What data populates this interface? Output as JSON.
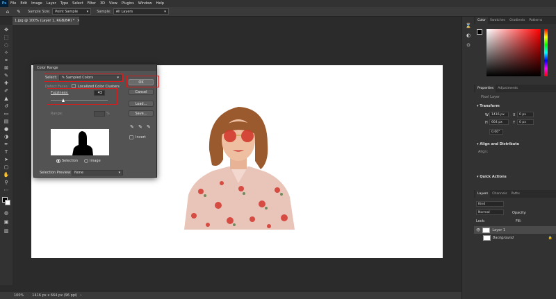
{
  "app": {
    "logo": "Ps",
    "menu": [
      "File",
      "Edit",
      "Image",
      "Layer",
      "Type",
      "Select",
      "Filter",
      "3D",
      "View",
      "Plugins",
      "Window",
      "Help"
    ]
  },
  "options": {
    "sample_size_label": "Sample Size:",
    "sample_size_value": "Point Sample",
    "sample_label": "Sample:",
    "sample_value": "All Layers"
  },
  "document": {
    "tab_title": "1.jpg @ 100% (Layer 1, RGB/8#) *"
  },
  "status": {
    "zoom": "100%",
    "info": "1416 px x 664 px (96 ppi)"
  },
  "color_panel": {
    "tabs": [
      "Color",
      "Swatches",
      "Gradients",
      "Patterns"
    ]
  },
  "properties_panel": {
    "tabs": [
      "Properties",
      "Adjustments"
    ],
    "layer_kind": "Pixel Layer",
    "transform_label": "Transform",
    "w_label": "W",
    "w_value": "1416 px",
    "h_label": "H",
    "h_value": "664 px",
    "x_label": "X",
    "x_value": "0 px",
    "y_label": "Y",
    "y_value": "0 px",
    "angle_value": "0.00°",
    "align_label": "Align and Distribute",
    "align_sub": "Align:",
    "quick_actions_label": "Quick Actions"
  },
  "layers_panel": {
    "tabs": [
      "Layers",
      "Channels",
      "Paths"
    ],
    "kind_placeholder": "Kind",
    "blend_mode": "Normal",
    "opacity_label": "Opacity:",
    "lock_label": "Lock:",
    "fill_label": "Fill:",
    "layers": [
      {
        "name": "Layer 1"
      },
      {
        "name": "Background"
      }
    ]
  },
  "dialog": {
    "title": "Color Range",
    "select_label": "Select:",
    "select_value": "Sampled Colors",
    "detect_faces_label": "Detect Faces",
    "localized_label": "Localized Color Clusters",
    "fuzziness_label": "Fuzziness:",
    "fuzziness_value": "43",
    "range_label": "Range:",
    "range_unit": "%",
    "selection_label": "Selection",
    "image_label": "Image",
    "preview_label": "Selection Preview:",
    "preview_value": "None",
    "ok_label": "OK",
    "cancel_label": "Cancel",
    "load_label": "Load...",
    "save_label": "Save...",
    "invert_label": "Invert"
  }
}
